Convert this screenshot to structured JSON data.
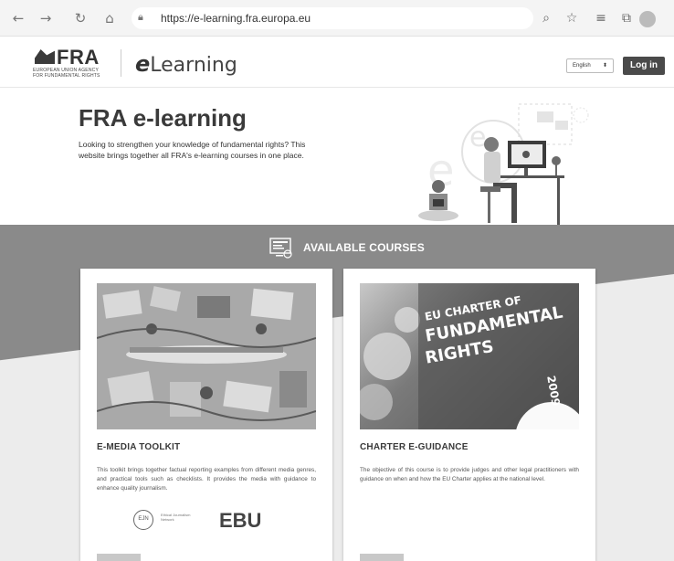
{
  "browser": {
    "url": "https://e-learning.fra.europa.eu",
    "icons": [
      "back-icon",
      "forward-icon",
      "refresh-icon",
      "home-icon",
      "lock-icon",
      "zoom-icon",
      "favorite-add-icon",
      "favorites-icon",
      "collections-icon",
      "profile-icon"
    ]
  },
  "header": {
    "logo_text": "FRA",
    "logo_sub_line1": "EUROPEAN UNION AGENCY",
    "logo_sub_line2": "FOR FUNDAMENTAL RIGHTS",
    "site_name_e": "e",
    "site_name_rest": "Learning",
    "language": "English",
    "login_label": "Log in"
  },
  "hero": {
    "title": "FRA e-learning",
    "description": "Looking to strengthen your knowledge of fundamental rights? This website brings together all FRA's e-learning courses in one place."
  },
  "courses": {
    "heading": "AVAILABLE COURSES",
    "items": [
      {
        "title": "E-MEDIA TOOLKIT",
        "description": "This toolkit brings together factual reporting examples from different media genres, and practical tools such as checklists. It provides the media with guidance to enhance quality journalism.",
        "partner_logos": {
          "fjn_mark": "EJN",
          "fjn_text": "Ethical Journalism Network",
          "ebu_text": "EBU"
        }
      },
      {
        "title": "CHARTER E-GUIDANCE",
        "description": "The objective of this course is to provide judges and other legal practitioners with guidance on when and how the EU Charter applies at the national level.",
        "image_text": {
          "line1": "EU CHARTER OF",
          "line2": "FUNDAMENTAL",
          "line3": "RIGHTS",
          "year": "2009"
        }
      }
    ]
  },
  "colors": {
    "band": "#8a8a8a",
    "login_bg": "#4a4a4a",
    "title_text": "#3a3a3a"
  }
}
